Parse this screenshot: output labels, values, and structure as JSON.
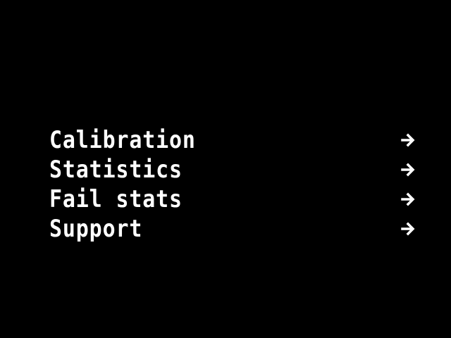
{
  "menu": {
    "items": [
      {
        "label": "Calibration",
        "arrow_icon": "arrow-right-icon"
      },
      {
        "label": "Statistics",
        "arrow_icon": "arrow-right-icon"
      },
      {
        "label": "Fail stats",
        "arrow_icon": "arrow-right-icon"
      },
      {
        "label": "Support",
        "arrow_icon": "arrow-right-icon"
      }
    ]
  },
  "colors": {
    "background": "#000000",
    "foreground": "#ffffff"
  }
}
